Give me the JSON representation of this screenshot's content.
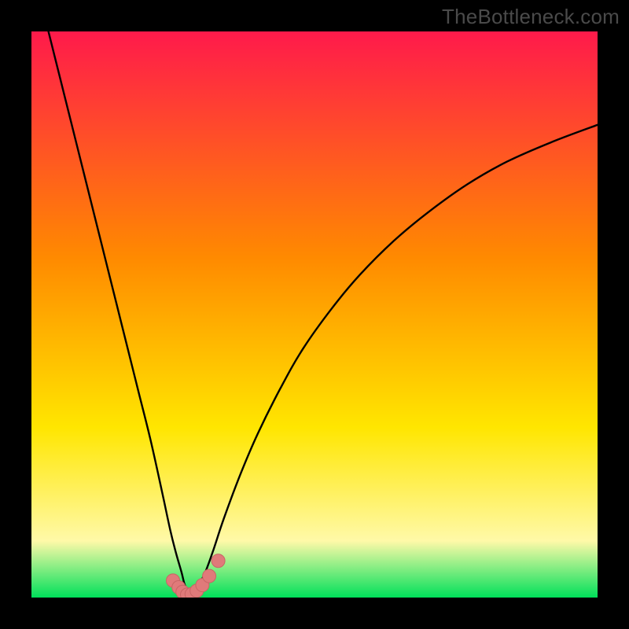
{
  "watermark": "TheBottleneck.com",
  "colors": {
    "frame": "#000000",
    "grad_top": "#ff1a4b",
    "grad_mid1": "#ff8a00",
    "grad_mid2": "#ffe600",
    "grad_low": "#fff9a8",
    "grad_green": "#00e05a",
    "curve": "#000000",
    "marker_fill": "#e07a7a",
    "marker_stroke": "#c96565"
  },
  "chart_data": {
    "type": "line",
    "title": "",
    "xlabel": "",
    "ylabel": "",
    "xlim": [
      0,
      100
    ],
    "ylim": [
      0,
      100
    ],
    "series": [
      {
        "name": "left-branch",
        "x": [
          3,
          5,
          7,
          9,
          11,
          13,
          15,
          17,
          19,
          21,
          23,
          24.5,
          25.5,
          26.5,
          27,
          27.5,
          28
        ],
        "y": [
          100,
          92,
          84,
          76,
          68,
          60,
          52,
          44,
          36,
          28,
          19,
          12,
          8,
          4.5,
          2.5,
          1.2,
          0.3
        ]
      },
      {
        "name": "right-branch",
        "x": [
          28,
          29,
          30.5,
          32,
          34,
          37,
          40,
          44,
          48,
          53,
          58,
          64,
          70,
          77,
          84,
          92,
          100
        ],
        "y": [
          0.3,
          1.5,
          4,
          8,
          14,
          22,
          29,
          37,
          44,
          51,
          57,
          63,
          68,
          73,
          77,
          80.5,
          83.5
        ]
      }
    ],
    "markers": {
      "name": "bottleneck-points",
      "x": [
        25.0,
        26.0,
        26.7,
        27.5,
        28.3,
        29.2,
        30.2,
        31.4,
        33.0
      ],
      "y": [
        3.0,
        1.8,
        1.0,
        0.5,
        0.6,
        1.2,
        2.2,
        3.8,
        6.5
      ]
    }
  }
}
